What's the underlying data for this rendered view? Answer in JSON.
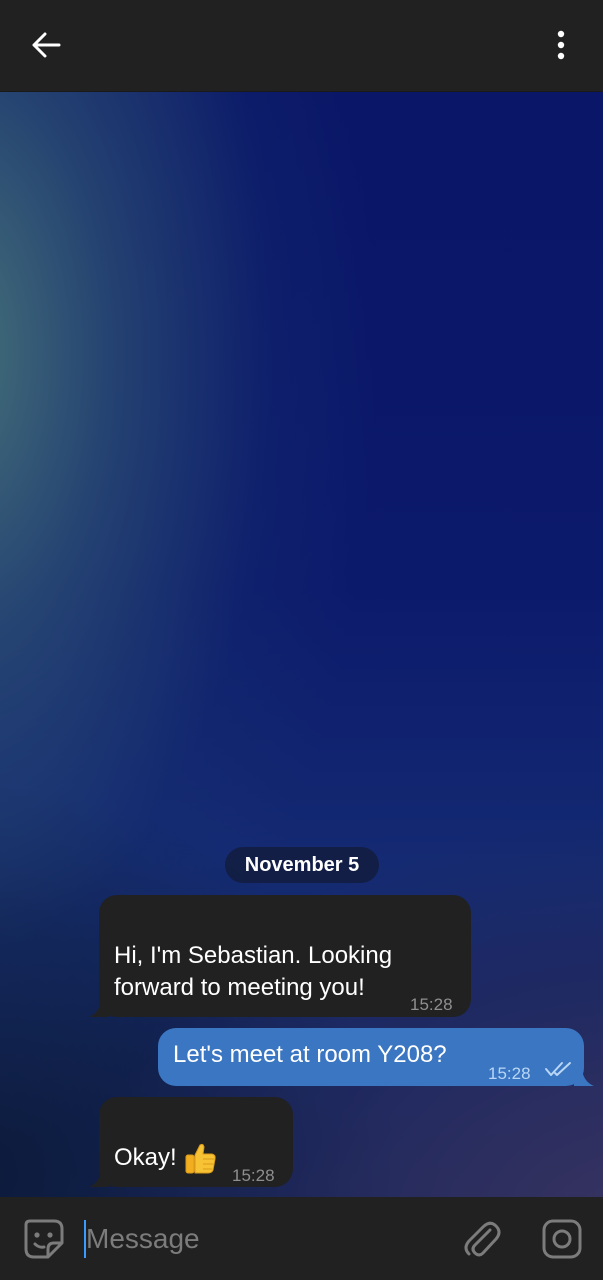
{
  "header": {
    "back_icon": "arrow-left-icon",
    "menu_icon": "more-vertical-icon"
  },
  "chat": {
    "date_label": "November 5",
    "messages": [
      {
        "direction": "incoming",
        "lines": [
          "Hi, I'm Sebastian. Looking",
          "forward to meeting you!"
        ],
        "time": "15:28"
      },
      {
        "direction": "outgoing",
        "text": "Let's meet at room Y208?",
        "time": "15:28",
        "status_icon": "double-check-icon"
      },
      {
        "direction": "incoming",
        "text": "Okay!",
        "emoji_icon": "thumbs-up-icon",
        "time": "15:28"
      }
    ]
  },
  "composer": {
    "placeholder": "Message",
    "value": "",
    "sticker_icon": "sticker-icon",
    "attach_icon": "paperclip-icon",
    "camera_icon": "camera-icon"
  },
  "colors": {
    "surface": "#212121",
    "outgoing_bubble": "#3a76c1",
    "incoming_bubble": "#212121",
    "cursor": "#3a9bff"
  }
}
